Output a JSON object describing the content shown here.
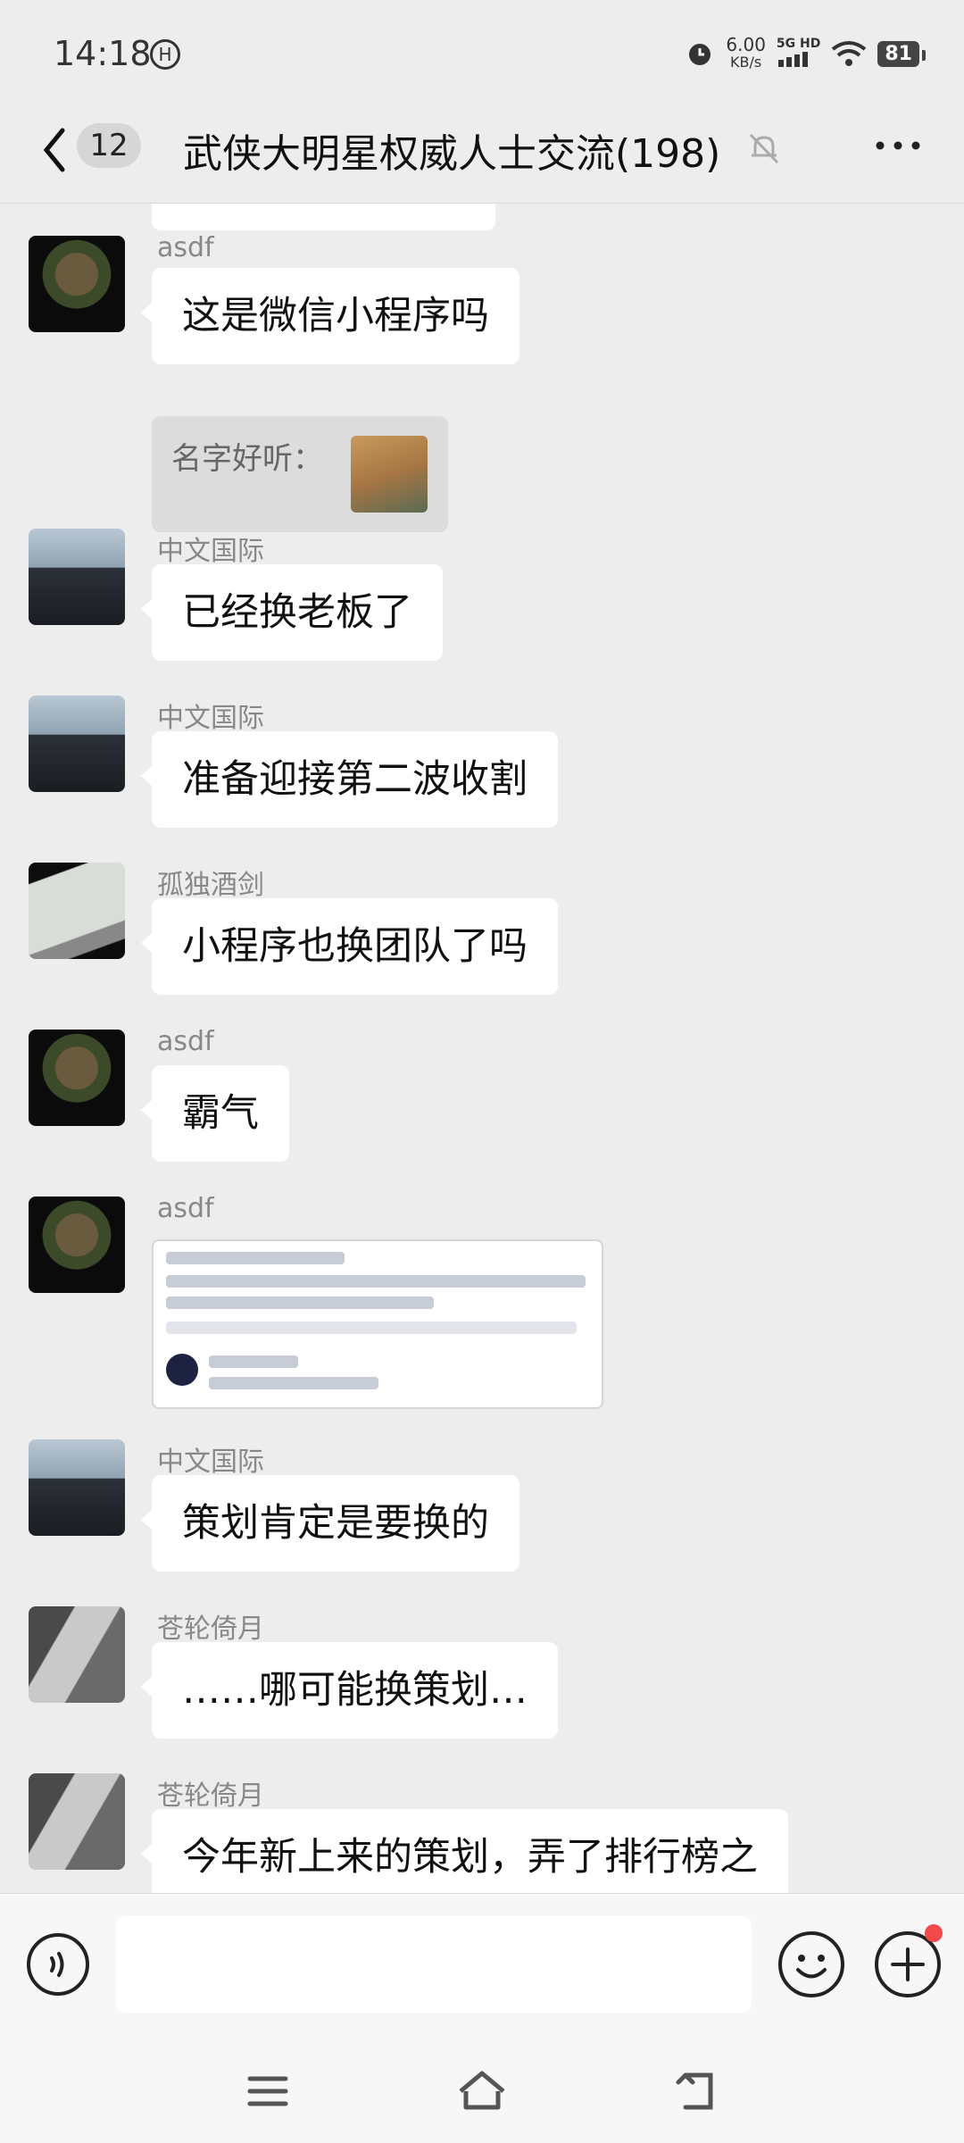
{
  "status_bar": {
    "time": "14:18",
    "hd_icon": "HD",
    "net_speed": "6.00",
    "net_unit": "KB/s",
    "network": "5G HD",
    "battery": "81"
  },
  "header": {
    "unread_count": "12",
    "title": "武侠大明星权威人士交流(198)"
  },
  "messages": [
    {
      "sender": "asdf",
      "text": "这是微信小程序吗",
      "quote_text": "名字好听："
    },
    {
      "sender": "中文国际",
      "text": "已经换老板了"
    },
    {
      "sender": "中文国际",
      "text": "准备迎接第二波收割"
    },
    {
      "sender": "孤独酒剑",
      "text": "小程序也换团队了吗"
    },
    {
      "sender": "asdf",
      "text": "霸气"
    },
    {
      "sender": "asdf",
      "image": "blurred-screenshot"
    },
    {
      "sender": "中文国际",
      "text": "策划肯定是要换的"
    },
    {
      "sender": "苍轮倚月",
      "text": "……哪可能换策划…"
    },
    {
      "sender": "苍轮倚月",
      "text": "今年新上来的策划，弄了排行榜之"
    }
  ],
  "input": {
    "value": ""
  },
  "colors": {
    "background": "#ededed",
    "bubble": "#ffffff",
    "badge_dot": "#f24a4a"
  }
}
